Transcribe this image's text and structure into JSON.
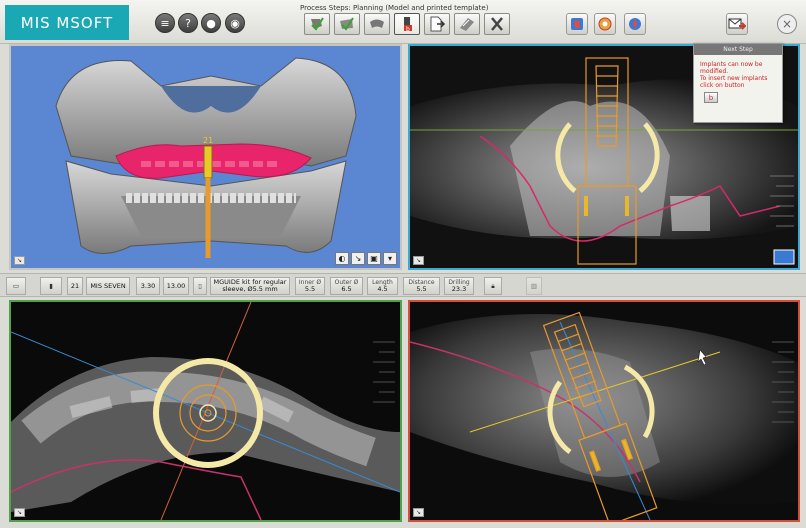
{
  "app": {
    "logo": "MIS MSOFT"
  },
  "toolbar": {
    "process_label": "Process Steps: Planning (Model and printed template)",
    "left_buttons": [
      {
        "icon": "list-icon",
        "glyph": "≡"
      },
      {
        "icon": "help-icon",
        "glyph": "?"
      },
      {
        "icon": "video-icon",
        "glyph": "●"
      },
      {
        "icon": "camera-icon",
        "glyph": "◉"
      }
    ],
    "close_glyph": "×"
  },
  "next_step": {
    "header": "Next Step",
    "line1": "Implants can now be modified.",
    "line2": "To insert new implants click on button",
    "button_glyph": "b"
  },
  "view3d": {
    "tooth_label": "21",
    "tools": [
      "◐",
      "↘",
      "▣",
      "▾"
    ]
  },
  "implant": {
    "tooth": "21",
    "brand": "MIS SEVEN",
    "diameter": "3.30",
    "length_main": "13.00",
    "kit": "MGUIDE kit for regular sleeve, Ø5.5 mm",
    "inner_label": "Inner Ø",
    "inner_value": "5.5",
    "outer_label": "Outer Ø",
    "outer_value": "6.5",
    "length_label": "Length",
    "length_value": "4.5",
    "distance_label": "Distance",
    "distance_value": "5.5",
    "drilling_label": "Drilling",
    "drilling_value": "23.3"
  },
  "colors": {
    "accent_teal": "#1aa8b5",
    "sagittal_border": "#3aaad2",
    "axial_border": "#4fa24a",
    "coronal_border": "#d2503a",
    "implant_orange": "#e89a2a",
    "sleeve_cream": "#f5e9a8",
    "nerve_magenta": "#c8326a"
  }
}
